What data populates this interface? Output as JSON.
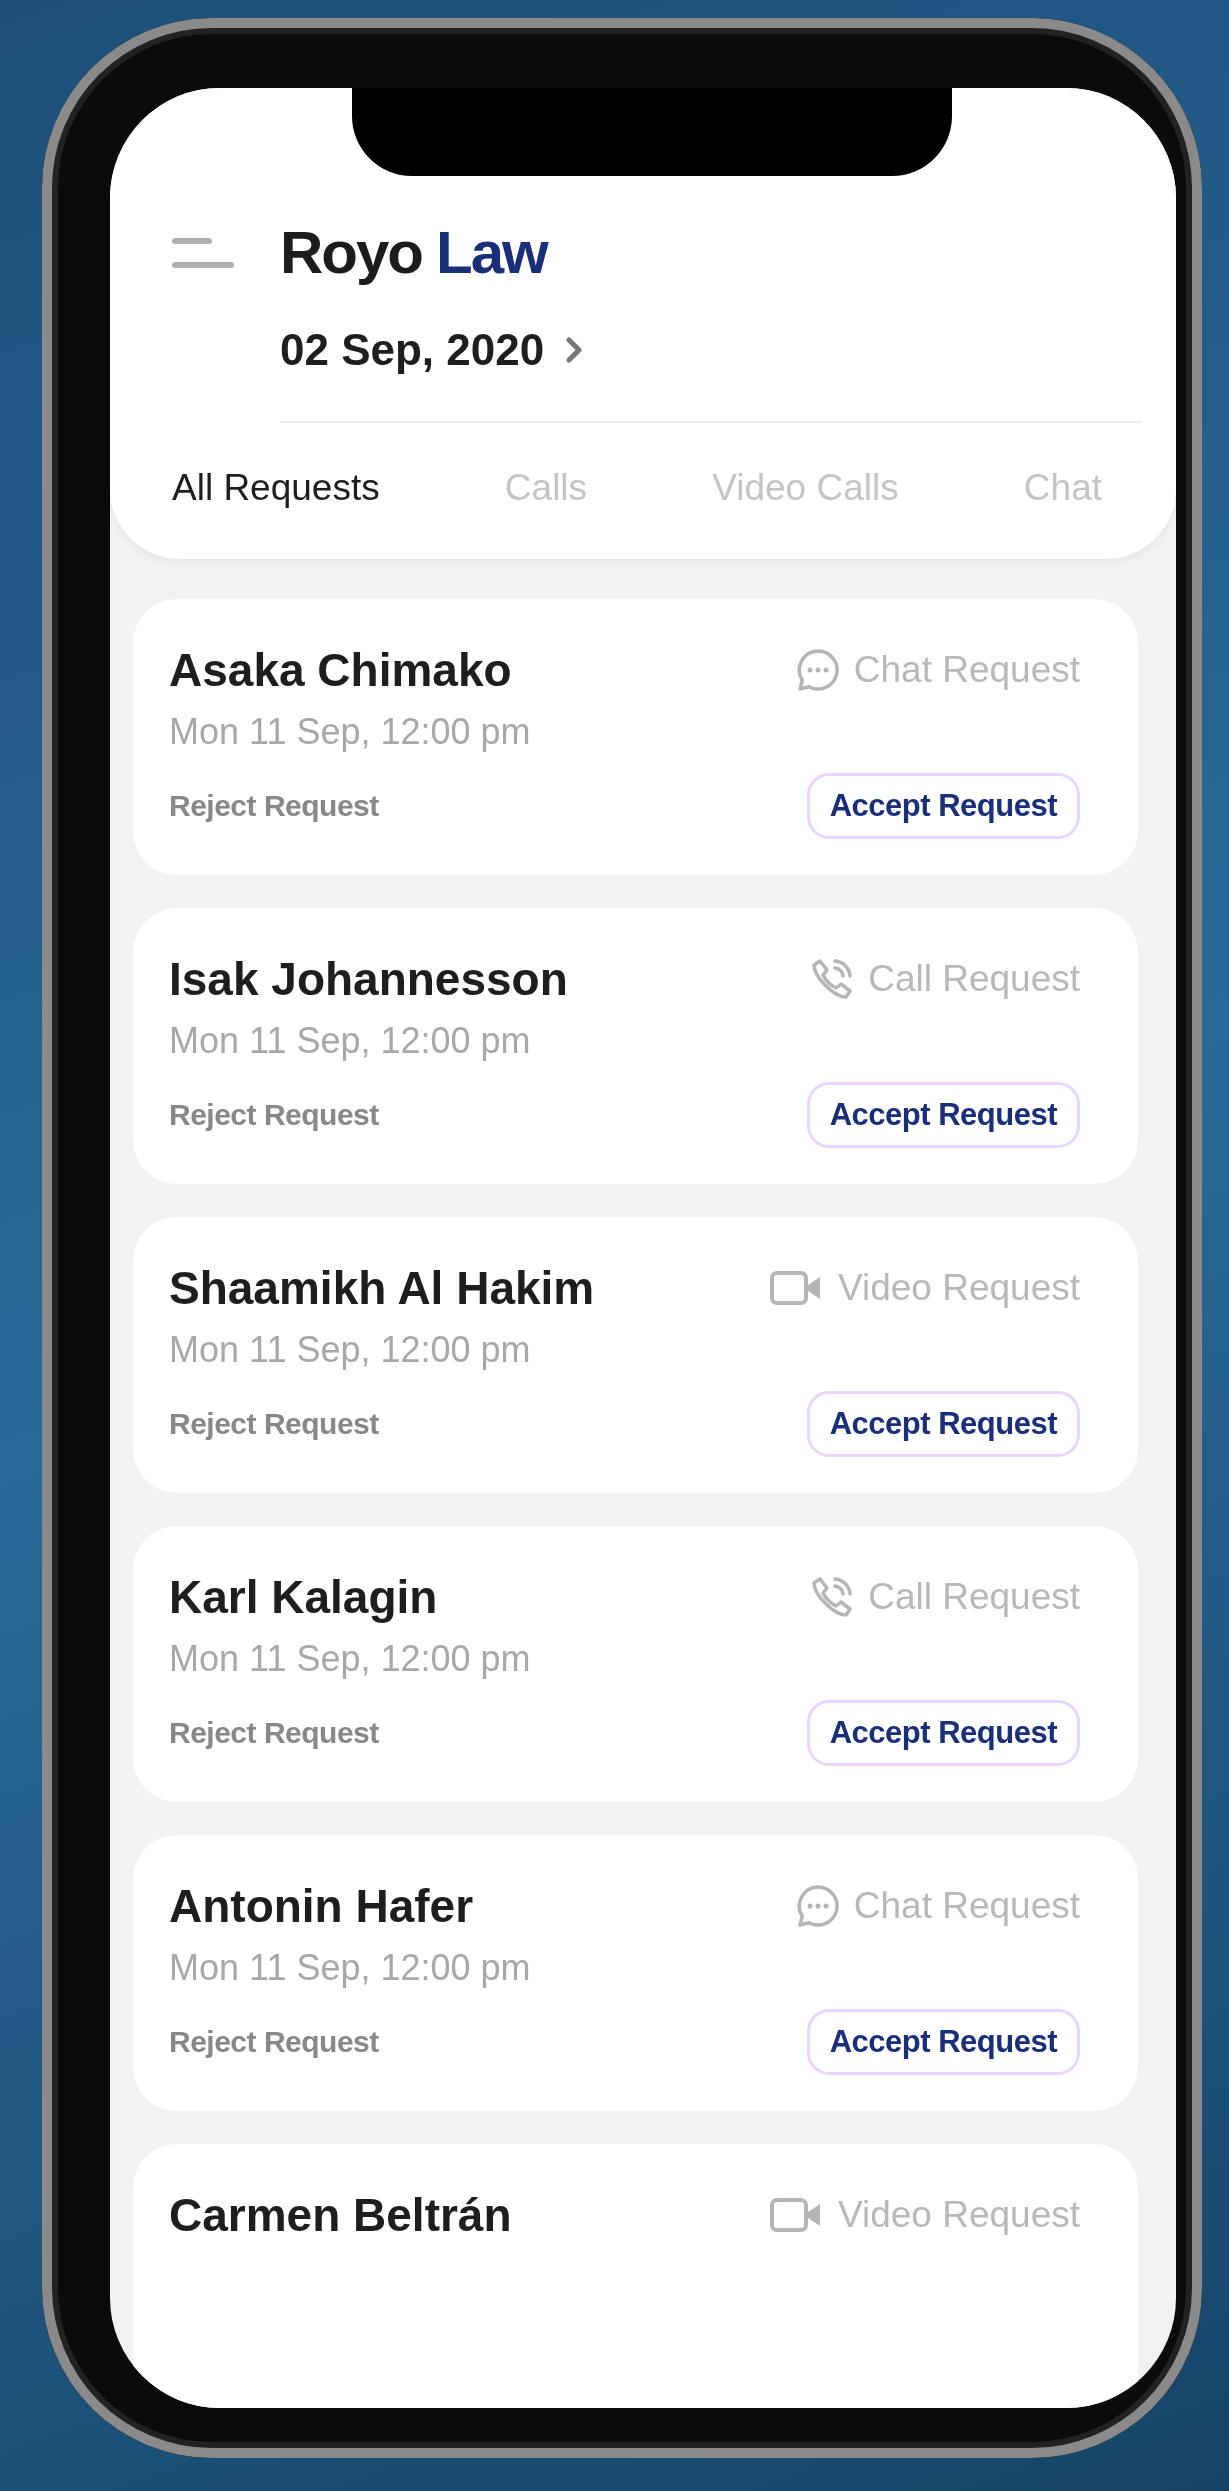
{
  "app": {
    "brand": "Royo",
    "brand_accent": "Law",
    "date": "02 Sep, 2020"
  },
  "tabs": [
    {
      "label": "All Requests",
      "selected": true
    },
    {
      "label": "Calls",
      "selected": false
    },
    {
      "label": "Video Calls",
      "selected": false
    },
    {
      "label": "Chat",
      "selected": false
    }
  ],
  "requests": [
    {
      "name": "Asaka Chimako",
      "datetime": "Mon 11 Sep, 12:00 pm",
      "kind": "chat",
      "type_label": "Chat Request",
      "reject": "Reject Request",
      "accept": "Accept Request"
    },
    {
      "name": "Isak Johannesson",
      "datetime": "Mon 11 Sep, 12:00 pm",
      "kind": "call",
      "type_label": "Call Request",
      "reject": "Reject Request",
      "accept": "Accept Request"
    },
    {
      "name": "Shaamikh Al Hakim",
      "datetime": "Mon 11 Sep, 12:00 pm",
      "kind": "video",
      "type_label": "Video Request",
      "reject": "Reject Request",
      "accept": "Accept Request"
    },
    {
      "name": "Karl Kalagin",
      "datetime": "Mon 11 Sep, 12:00 pm",
      "kind": "call",
      "type_label": "Call Request",
      "reject": "Reject Request",
      "accept": "Accept Request"
    },
    {
      "name": "Antonin Hafer",
      "datetime": "Mon 11 Sep, 12:00 pm",
      "kind": "chat",
      "type_label": "Chat Request",
      "reject": "Reject Request",
      "accept": "Accept Request"
    },
    {
      "name": "Carmen Beltrán",
      "kind": "video",
      "type_label": "Video Request"
    }
  ]
}
